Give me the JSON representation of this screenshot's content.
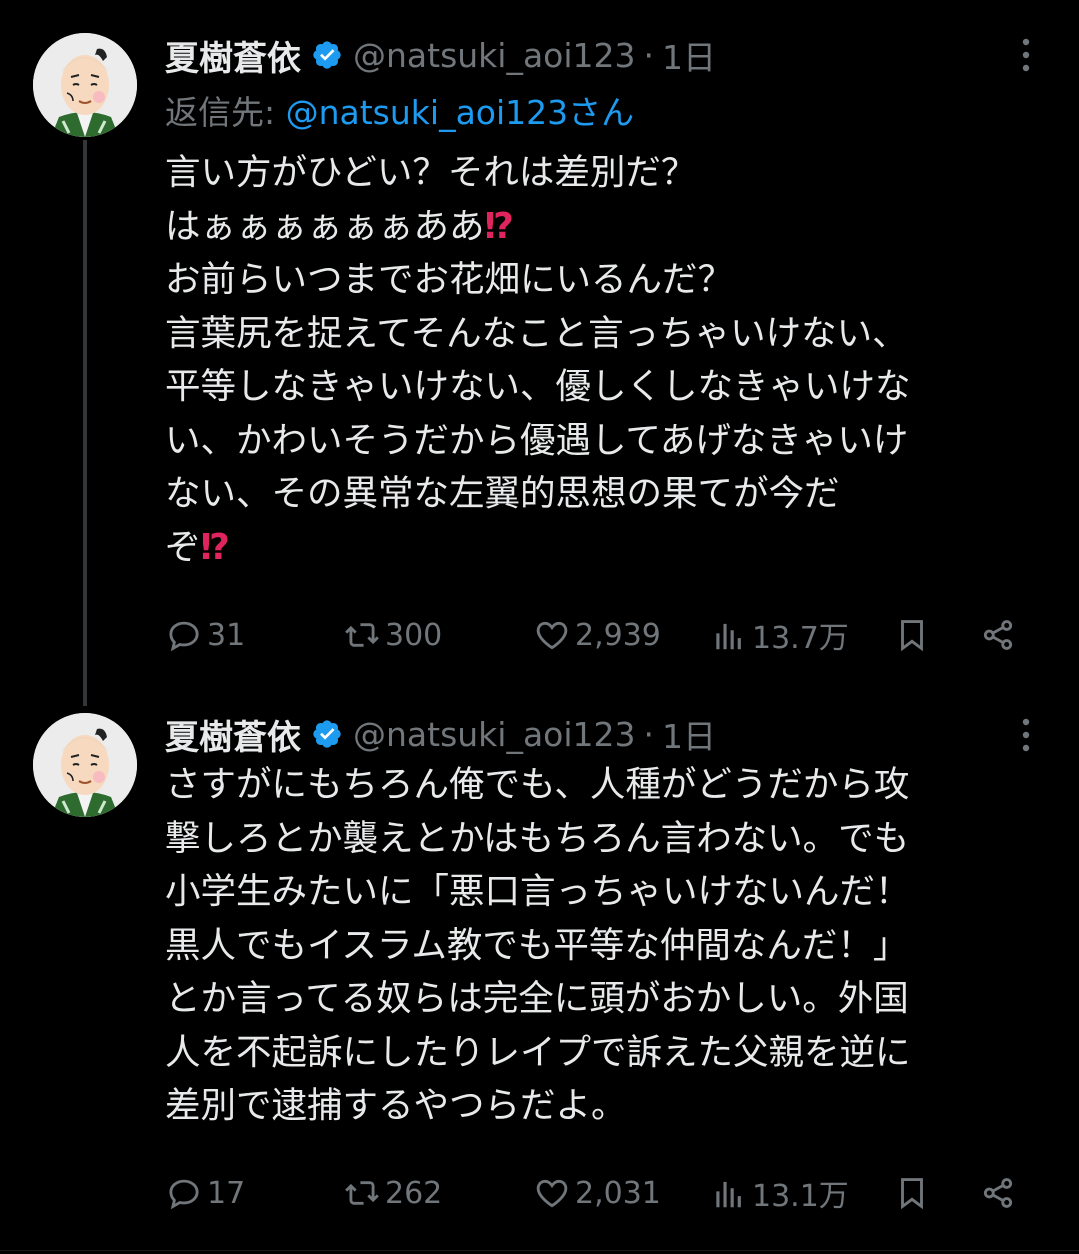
{
  "posts": [
    {
      "name": "夏樹蒼依",
      "handle": "@natsuki_aoi123",
      "separator": "·",
      "time": "1日",
      "reply_prefix": "返信先: ",
      "reply_handle": "@natsuki_aoi123さん",
      "lines": [
        {
          "text": "言い方がひどい？それは差別だ？",
          "emoji": ""
        },
        {
          "text": "はぁぁぁぁぁぁああ",
          "emoji": "⁉"
        },
        {
          "text": "お前らいつまでお花畑にいるんだ？",
          "emoji": ""
        },
        {
          "text": "言葉尻を捉えてそんなこと言っちゃいけない、",
          "emoji": ""
        },
        {
          "text": "平等しなきゃいけない、優しくしなきゃいけな",
          "emoji": ""
        },
        {
          "text": "い、かわいそうだから優遇してあげなきゃいけ",
          "emoji": ""
        },
        {
          "text": "ない、その異常な左翼的思想の果てが今だ",
          "emoji": ""
        },
        {
          "text": "ぞ",
          "emoji": "⁉"
        }
      ],
      "stats": {
        "replies": "31",
        "reposts": "300",
        "likes": "2,939",
        "views": "13.7万"
      }
    },
    {
      "name": "夏樹蒼依",
      "handle": "@natsuki_aoi123",
      "separator": "·",
      "time": "1日",
      "lines": [
        {
          "text": "さすがにもちろん俺でも、人種がどうだから攻",
          "emoji": ""
        },
        {
          "text": "撃しろとか襲えとかはもちろん言わない。でも",
          "emoji": ""
        },
        {
          "text": "小学生みたいに「悪口言っちゃいけないんだ！",
          "emoji": ""
        },
        {
          "text": "黒人でもイスラム教でも平等な仲間なんだ！」",
          "emoji": ""
        },
        {
          "text": "とか言ってる奴らは完全に頭がおかしい。外国",
          "emoji": ""
        },
        {
          "text": "人を不起訴にしたりレイプで訴えた父親を逆に",
          "emoji": ""
        },
        {
          "text": "差別で逮捕するやつらだよ。",
          "emoji": ""
        }
      ],
      "stats": {
        "replies": "17",
        "reposts": "262",
        "likes": "2,031",
        "views": "13.1万"
      }
    }
  ],
  "colors": {
    "background": "#000000",
    "text": "#e7e9ea",
    "muted": "#71767b",
    "link": "#1d9bf0",
    "verified": "#1d9bf0",
    "emoji": "#e0245e"
  },
  "icons": [
    "avatar",
    "verified-badge-icon",
    "more-icon",
    "reply-icon",
    "repost-icon",
    "like-icon",
    "views-icon",
    "bookmark-icon",
    "share-icon"
  ]
}
